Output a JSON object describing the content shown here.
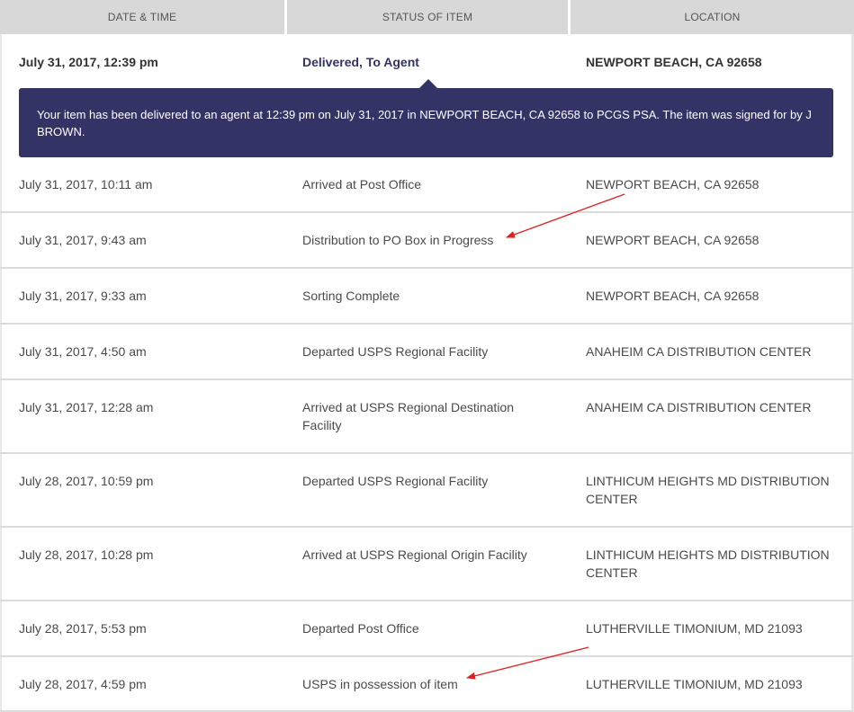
{
  "headers": {
    "date_time": "DATE & TIME",
    "status": "STATUS OF ITEM",
    "location": "LOCATION"
  },
  "first_event": {
    "date": "July 31, 2017, 12:39 pm",
    "status": "Delivered, To Agent",
    "location": "NEWPORT BEACH, CA 92658",
    "detail": "Your item has been delivered to an agent at 12:39 pm on July 31, 2017 in NEWPORT BEACH, CA 92658 to PCGS PSA. The item was signed for by J BROWN."
  },
  "events": [
    {
      "date": "July 31, 2017, 10:11 am",
      "status": "Arrived at Post Office",
      "location": "NEWPORT BEACH, CA 92658"
    },
    {
      "date": "July 31, 2017, 9:43 am",
      "status": "Distribution to PO Box in Progress",
      "location": "NEWPORT BEACH, CA 92658"
    },
    {
      "date": "July 31, 2017, 9:33 am",
      "status": "Sorting Complete",
      "location": "NEWPORT BEACH, CA 92658"
    },
    {
      "date": "July 31, 2017, 4:50 am",
      "status": "Departed USPS Regional Facility",
      "location": "ANAHEIM CA DISTRIBUTION CENTER"
    },
    {
      "date": "July 31, 2017, 12:28 am",
      "status": "Arrived at USPS Regional Destination Facility",
      "location": "ANAHEIM CA DISTRIBUTION CENTER"
    },
    {
      "date": "July 28, 2017, 10:59 pm",
      "status": "Departed USPS Regional Facility",
      "location": "LINTHICUM HEIGHTS MD DISTRIBUTION CENTER"
    },
    {
      "date": "July 28, 2017, 10:28 pm",
      "status": "Arrived at USPS Regional Origin Facility",
      "location": "LINTHICUM HEIGHTS MD DISTRIBUTION CENTER"
    },
    {
      "date": "July 28, 2017, 5:53 pm",
      "status": "Departed Post Office",
      "location": "LUTHERVILLE TIMONIUM, MD 21093"
    },
    {
      "date": "July 28, 2017, 4:59 pm",
      "status": "USPS in possession of item",
      "location": "LUTHERVILLE TIMONIUM, MD 21093"
    }
  ],
  "colors": {
    "header_bg": "#d8d8d8",
    "callout_bg": "#333366",
    "annotation_arrow": "#e02020"
  }
}
